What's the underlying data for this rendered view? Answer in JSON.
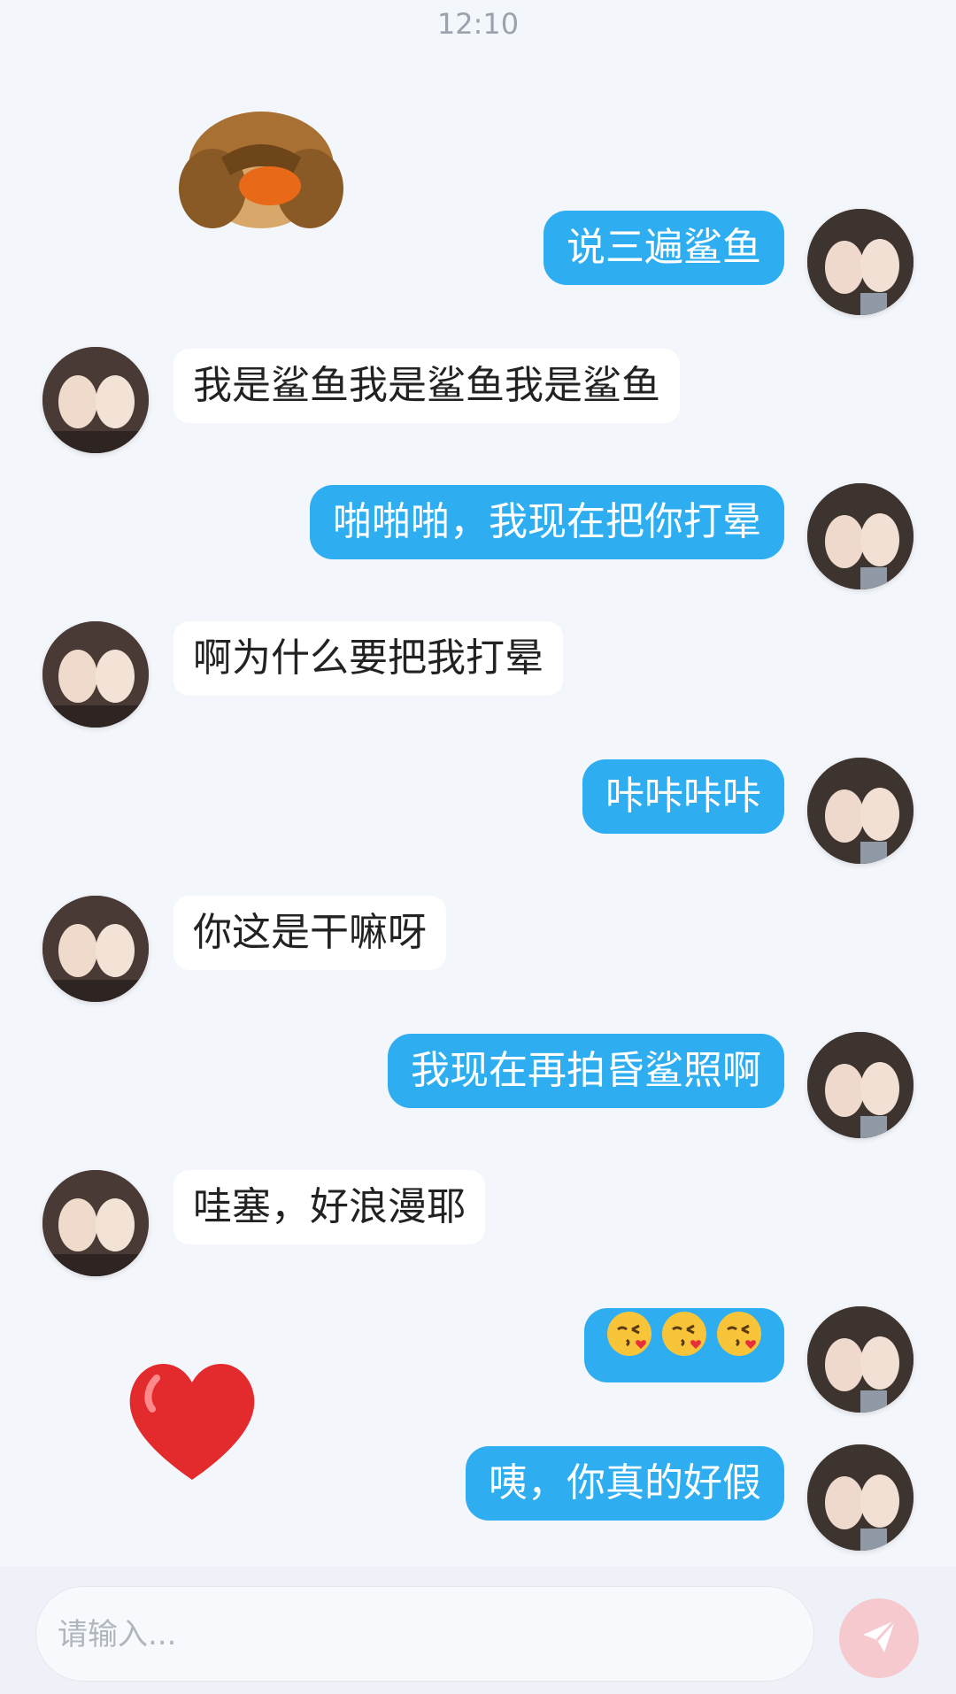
{
  "status_bar": {
    "time": "12:10"
  },
  "messages": [
    {
      "id": "m1",
      "side": "right",
      "text": "说三遍鲨鱼"
    },
    {
      "id": "m2",
      "side": "left",
      "text": "我是鲨鱼我是鲨鱼我是鲨鱼"
    },
    {
      "id": "m3",
      "side": "right",
      "text": "啪啪啪，我现在把你打晕"
    },
    {
      "id": "m4",
      "side": "left",
      "text": "啊为什么要把我打晕"
    },
    {
      "id": "m5",
      "side": "right",
      "text": "咔咔咔咔"
    },
    {
      "id": "m6",
      "side": "left",
      "text": "你这是干嘛呀"
    },
    {
      "id": "m7",
      "side": "right",
      "text": "我现在再拍昏鲨照啊"
    },
    {
      "id": "m8",
      "side": "left",
      "text": "哇塞，好浪漫耶"
    },
    {
      "id": "m9",
      "side": "right",
      "emoji": [
        "face-blowing-kiss",
        "face-blowing-kiss",
        "face-blowing-kiss"
      ]
    },
    {
      "id": "m10",
      "side": "right",
      "text": "咦，你真的好假"
    }
  ],
  "stickers": [
    {
      "name": "monkey-covering-eyes"
    },
    {
      "name": "red-heart"
    }
  ],
  "input": {
    "placeholder": "请输入..."
  },
  "colors": {
    "right_bubble": "#2eaef0",
    "left_bubble": "#ffffff",
    "background": "#f3f6fb",
    "send_button": "#f6c9cf"
  }
}
